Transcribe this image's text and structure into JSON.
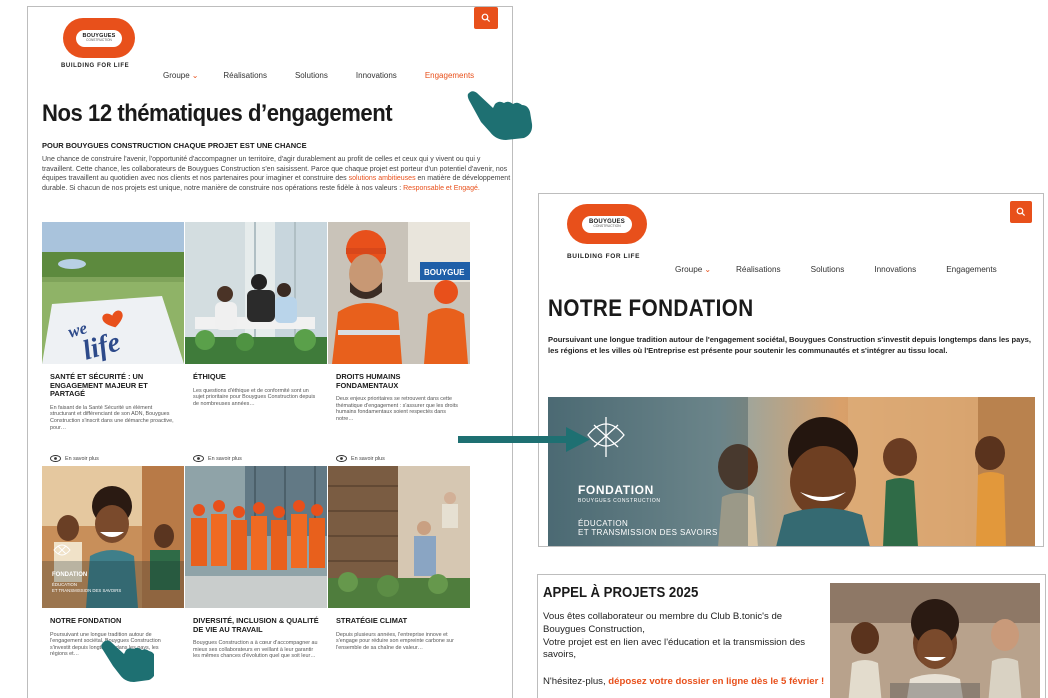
{
  "left_page": {
    "logo": {
      "line1": "BOUYGUES",
      "line2": "CONSTRUCTION"
    },
    "tagline": "BUILDING FOR LIFE",
    "nav": [
      {
        "label": "Groupe",
        "has_chevron": true,
        "active": false
      },
      {
        "label": "Réalisations",
        "has_chevron": false,
        "active": false
      },
      {
        "label": "Solutions",
        "has_chevron": false,
        "active": false
      },
      {
        "label": "Innovations",
        "has_chevron": false,
        "active": false
      },
      {
        "label": "Engagements",
        "has_chevron": false,
        "active": true
      }
    ],
    "title": "Nos 12 thématiques d’engagement",
    "subtitle": "POUR BOUYGUES CONSTRUCTION CHAQUE PROJET EST UNE CHANCE",
    "intro_a": "Une chance de construire l'avenir, l'opportunité d'accompagner un territoire, d'agir durablement au profit de celles et ceux qui y vivent ou qui y travaillent. Cette chance, les collaborateurs de Bouygues Construction s'en saisissent. Parce que chaque projet est porteur d'un potentiel d'avenir, nos équipes travaillent au quotidien avec nos clients et nos partenaires pour imaginer et construire des",
    "intro_link1": "solutions ambitieuses",
    "intro_b": "en matière de développement durable. Si chacun de nos projets est unique, notre manière de construire nos opérations reste fidèle à nos valeurs :",
    "intro_link2": "Responsable et Engagé.",
    "more_label": "En savoir plus",
    "cards": [
      {
        "title": "SANTÉ ET SÉCURITÉ : UN ENGAGEMENT MAJEUR ET PARTAGÉ",
        "text": "En faisant de la Santé Sécurité un élément structurant et différenciant de son ADN, Bouygues Construction s'inscrit dans une démarche proactive, pour…",
        "image_text": "we life"
      },
      {
        "title": "ÉTHIQUE",
        "text": "Les questions d'éthique et de conformité sont un sujet prioritaire pour Bouygues Construction depuis de nombreuses années…"
      },
      {
        "title": "DROITS HUMAINS FONDAMENTAUX",
        "text": "Deux enjeux prioritaires se retrouvent dans cette thématique d'engagement : s'assurer que les droits humains fondamentaux soient respectés dans notre…",
        "image_text": "BOUYGUE"
      },
      {
        "title": "NOTRE FONDATION",
        "text": "Poursuivant une longue tradition autour de l'engagement sociétal, Bouygues Construction s'investit depuis longtemps dans les pays, les régions et…",
        "image_text": "FONDATION",
        "image_text2": "ÉDUCATION ET TRANSMISSION DES SAVOIRS"
      },
      {
        "title": "DIVERSITÉ, INCLUSION & QUALITÉ DE VIE AU TRAVAIL",
        "text": "Bouygues Construction a à cœur d'accompagner au mieux ses collaborateurs en veillant à leur garantir les mêmes chances d'évolution quel que soit leur…"
      },
      {
        "title": "STRATÉGIE CLIMAT",
        "text": "Depuis plusieurs années, l'entreprise innove et s'engage pour réduire son empreinte carbone sur l'ensemble de sa chaîne de valeur…"
      }
    ]
  },
  "fondation_page": {
    "logo": {
      "line1": "BOUYGUES",
      "line2": "CONSTRUCTION"
    },
    "tagline": "BUILDING FOR LIFE",
    "nav": [
      {
        "label": "Groupe",
        "has_chevron": true
      },
      {
        "label": "Réalisations",
        "has_chevron": false
      },
      {
        "label": "Solutions",
        "has_chevron": false
      },
      {
        "label": "Innovations",
        "has_chevron": false
      },
      {
        "label": "Engagements",
        "has_chevron": false
      }
    ],
    "title": "NOTRE FONDATION",
    "intro": "Poursuivant une longue tradition autour de l'engagement sociétal, Bouygues Construction s'investit depuis longtemps dans les pays, les régions et les villes où l'Entreprise est présente pour soutenir les communautés et s'intégrer au tissu local.",
    "banner": {
      "line1": "FONDATION",
      "line2": "BOUYGUES CONSTRUCTION",
      "line3": "ÉDUCATION",
      "line4": "ET TRANSMISSION DES SAVOIRS"
    }
  },
  "appel_panel": {
    "title": "APPEL À PROJETS 2025",
    "line1": "Vous êtes collaborateur ou membre du Club B.tonic's de Bouygues Construction,",
    "line2": "Votre projet est en lien avec l'éducation et la transmission des savoirs,",
    "cta_prefix": "N'hésitez-plus,",
    "cta_link": "déposez votre dossier en ligne dès le 5 février !"
  },
  "colors": {
    "brand": "#e8501b",
    "pointer": "#1e7072"
  }
}
